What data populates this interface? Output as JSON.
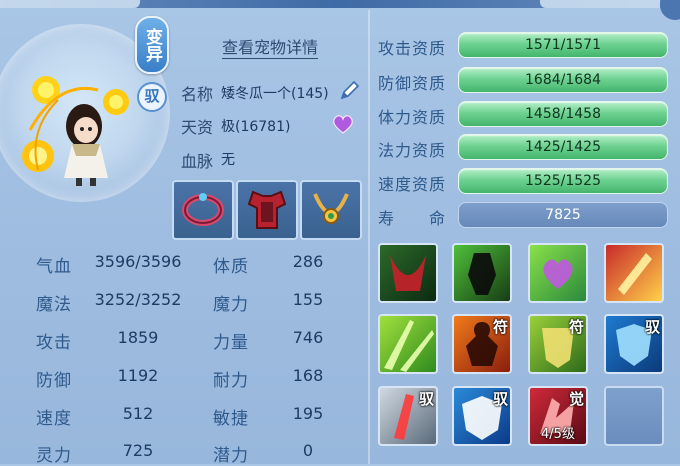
{
  "pet": {
    "badge_variant": "变异",
    "badge_ride": "驭",
    "detail_link": "查看宠物详情",
    "name_label": "名称",
    "name_value": "矮冬瓜一个(145)",
    "aptitude_label": "天资",
    "aptitude_value": "极(16781)",
    "bloodline_label": "血脉",
    "bloodline_value": "无"
  },
  "icons": {
    "edit": "pencil-icon",
    "heart": "purple-heart-icon"
  },
  "equipment": [
    "ring-equipment-icon",
    "armor-equipment-icon",
    "necklace-equipment-icon"
  ],
  "stats": [
    {
      "label": "气血",
      "value": "3596/3596",
      "label2": "体质",
      "value2": "286"
    },
    {
      "label": "魔法",
      "value": "3252/3252",
      "label2": "魔力",
      "value2": "155"
    },
    {
      "label": "攻击",
      "value": "1859",
      "label2": "力量",
      "value2": "746"
    },
    {
      "label": "防御",
      "value": "1192",
      "label2": "耐力",
      "value2": "168"
    },
    {
      "label": "速度",
      "value": "512",
      "label2": "敏捷",
      "value2": "195"
    },
    {
      "label": "灵力",
      "value": "725",
      "label2": "潜力",
      "value2": "0"
    }
  ],
  "aptitudes": [
    {
      "label": "攻击资质",
      "value": "1571/1571"
    },
    {
      "label": "防御资质",
      "value": "1684/1684"
    },
    {
      "label": "体力资质",
      "value": "1458/1458"
    },
    {
      "label": "法力资质",
      "value": "1425/1425"
    },
    {
      "label": "速度资质",
      "value": "1525/1525"
    }
  ],
  "life": {
    "label": "寿　　命",
    "value": "7825"
  },
  "skills": [
    {
      "icon": "bleed-skill-icon"
    },
    {
      "icon": "shadow-warrior-skill-icon"
    },
    {
      "icon": "heart-burst-skill-icon"
    },
    {
      "icon": "scroll-strike-skill-icon"
    },
    {
      "icon": "green-rays-skill-icon"
    },
    {
      "icon": "fire-figure-skill-icon",
      "tag": "符"
    },
    {
      "icon": "green-shield-skill-icon",
      "tag": "符"
    },
    {
      "icon": "blue-shield-skill-icon",
      "tag": "驭"
    },
    {
      "icon": "sword-fist-skill-icon",
      "tag": "驭"
    },
    {
      "icon": "ice-shield-skill-icon",
      "tag": "驭"
    },
    {
      "icon": "red-claw-skill-icon",
      "tag": "觉",
      "level": "4/5级"
    },
    {
      "icon": "empty-slot"
    }
  ],
  "colors": {
    "bar_green": "#5fcd88",
    "bar_blue": "#6f90c2",
    "heart": "#b05ae0"
  }
}
